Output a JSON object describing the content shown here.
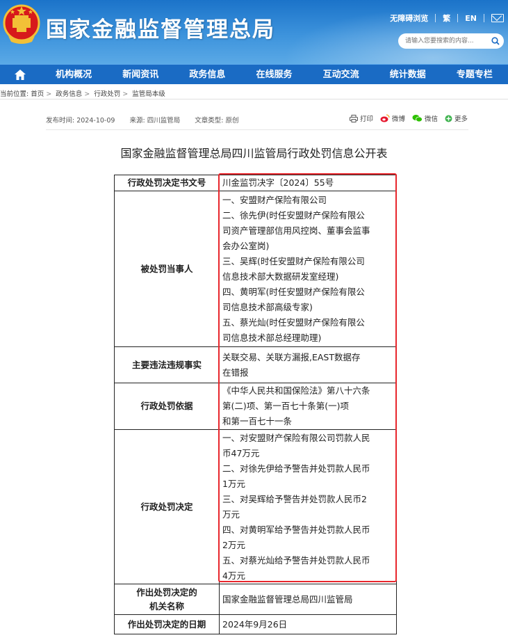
{
  "site": {
    "title": "国家金融监督管理总局",
    "toplinks": [
      "无障碍浏览",
      "繁",
      "EN"
    ],
    "search_placeholder": "请输入您要搜索的内容..."
  },
  "nav": {
    "items": [
      "机构概况",
      "新闻资讯",
      "政务信息",
      "在线服务",
      "互动交流",
      "统计数据",
      "专题专栏"
    ]
  },
  "breadcrumb": {
    "label": "当前位置:",
    "items": [
      "首页",
      "政务信息",
      "行政处罚",
      "监管局本级"
    ]
  },
  "meta": {
    "publish": "发布时间: 2024-10-09",
    "source": "来源: 四川监管局",
    "doctype": "文章类型: 原创"
  },
  "share": {
    "print": "打印",
    "weibo": "微博",
    "wechat": "微信",
    "more": "更多"
  },
  "article": {
    "title": "国家金融监督管理总局四川监管局行政处罚信息公开表"
  },
  "table": {
    "rows": [
      {
        "key": "行政处罚决定书文号",
        "lines": [
          "川金监罚决字〔2024〕55号"
        ]
      },
      {
        "key": "被处罚当事人",
        "lines": [
          "一、安盟财产保险有限公司",
          "二、徐先伊(时任安盟财产保险有限公",
          "司资产管理部信用风控岗、董事会监事",
          "会办公室岗)",
          "三、吴辉(时任安盟财产保险有限公司",
          "信息技术部大数据研发室经理)",
          "四、黄明军(时任安盟财产保险有限公",
          "司信息技术部高级专家)",
          "五、蔡光灿(时任安盟财产保险有限公",
          "司信息技术部总经理助理)"
        ]
      },
      {
        "key": "主要违法违规事实",
        "lines": [
          "关联交易、关联方漏报,EAST数据存",
          "在错报"
        ]
      },
      {
        "key": "行政处罚依据",
        "lines": [
          "《中华人民共和国保险法》第八十六条",
          "第(二)项、第一百七十条第(一)项",
          "和第一百七十一条"
        ]
      },
      {
        "key": "行政处罚决定",
        "lines": [
          "一、对安盟财产保险有限公司罚款人民",
          "币47万元",
          "二、对徐先伊给予警告并处罚款人民币",
          "1万元",
          "三、对吴辉给予警告并处罚款人民币2",
          "万元",
          "四、对黄明军给予警告并处罚款人民币",
          "2万元",
          "五、对蔡光灿给予警告并处罚款人民币",
          "4万元"
        ]
      },
      {
        "key": "作出处罚决定的\n机关名称",
        "lines": [
          "国家金融监督管理总局四川监管局"
        ]
      },
      {
        "key": "作出处罚决定的日期",
        "lines": [
          "2024年9月26日"
        ]
      }
    ]
  },
  "colors": {
    "header_blue": "#1b73c9",
    "nav_blue": "#1a6bc4",
    "highlight_red": "#e8262c"
  }
}
